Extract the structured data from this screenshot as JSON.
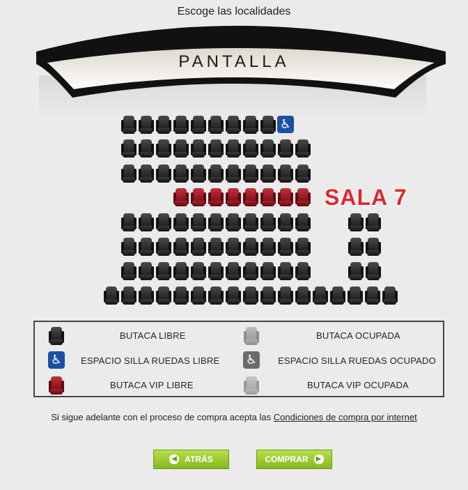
{
  "header": {
    "title": "Escoge las localidades"
  },
  "screen": {
    "label": "PANTALLA"
  },
  "room": {
    "label": "SALA 7"
  },
  "seat_icons": {
    "free": "seat-free-icon",
    "vip": "seat-vip-icon",
    "wheelchair": "wheelchair-icon"
  },
  "legend": {
    "free": "BUTACA LIBRE",
    "taken": "BUTACA OCUPADA",
    "wheel_free": "ESPACIO SILLA RUEDAS LIBRE",
    "wheel_taken": "ESPACIO SILLA RUEDAS OCUPADO",
    "vip_free": "BUTACA VIP LIBRE",
    "vip_taken": "BUTACA VIP OCUPADA"
  },
  "notice": {
    "text": "Si sigue adelante con el proceso de compra acepta las ",
    "link": "Condiciones de compra por internet"
  },
  "buttons": {
    "back": "ATRÁS",
    "buy": "COMPRAR"
  },
  "colors": {
    "vip": "#a8202c",
    "wheelchair": "#1b4fa3",
    "button": "#86b71d",
    "room_label": "#e0262f"
  }
}
